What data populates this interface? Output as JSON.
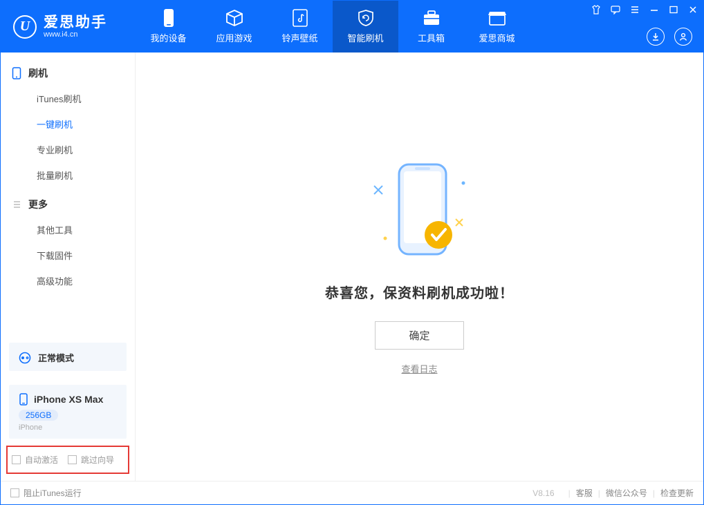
{
  "app": {
    "title": "爱思助手",
    "subtitle": "www.i4.cn"
  },
  "nav": {
    "tabs": [
      {
        "label": "我的设备"
      },
      {
        "label": "应用游戏"
      },
      {
        "label": "铃声壁纸"
      },
      {
        "label": "智能刷机"
      },
      {
        "label": "工具箱"
      },
      {
        "label": "爱思商城"
      }
    ]
  },
  "sidebar": {
    "group1": {
      "title": "刷机"
    },
    "items1": [
      {
        "label": "iTunes刷机"
      },
      {
        "label": "一键刷机"
      },
      {
        "label": "专业刷机"
      },
      {
        "label": "批量刷机"
      }
    ],
    "group2": {
      "title": "更多"
    },
    "items2": [
      {
        "label": "其他工具"
      },
      {
        "label": "下载固件"
      },
      {
        "label": "高级功能"
      }
    ],
    "device": {
      "mode": "正常模式",
      "name": "iPhone XS Max",
      "storage": "256GB",
      "type": "iPhone"
    },
    "options": {
      "auto_activate": "自动激活",
      "skip_guide": "跳过向导"
    }
  },
  "main": {
    "success_title": "恭喜您，保资料刷机成功啦！",
    "ok": "确定",
    "view_log": "查看日志"
  },
  "footer": {
    "block_itunes": "阻止iTunes运行",
    "version": "V8.16",
    "links": [
      {
        "label": "客服"
      },
      {
        "label": "微信公众号"
      },
      {
        "label": "检查更新"
      }
    ]
  }
}
